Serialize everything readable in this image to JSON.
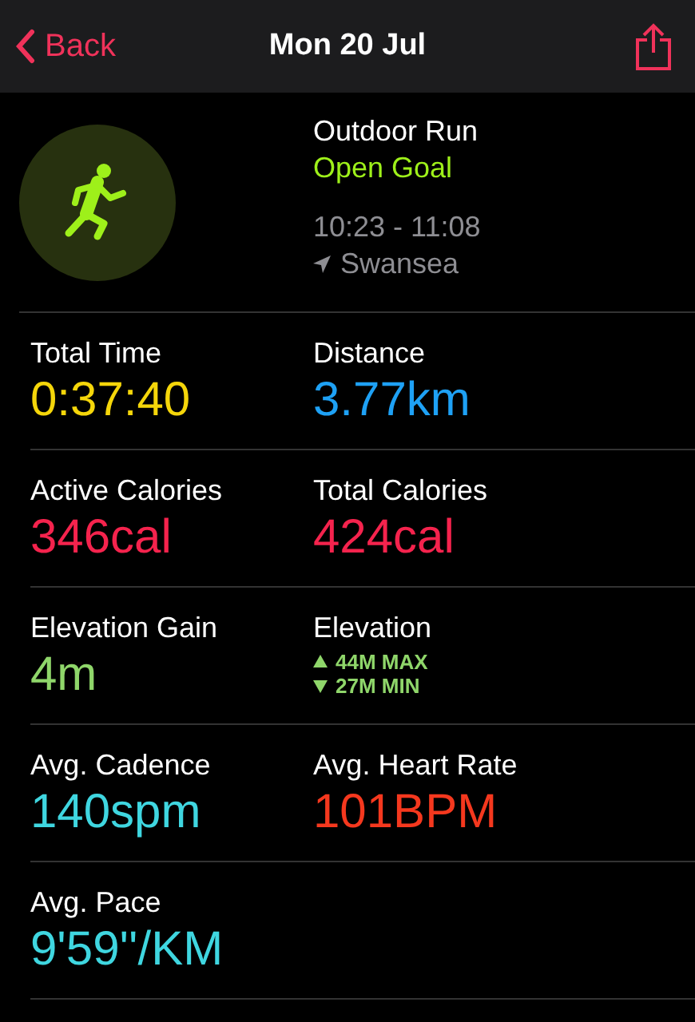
{
  "nav": {
    "back": "Back",
    "title": "Mon 20 Jul"
  },
  "workout": {
    "type": "Outdoor Run",
    "goal": "Open Goal",
    "time": "10:23 - 11:08",
    "location": "Swansea"
  },
  "metrics": [
    {
      "kind": "value",
      "label": "Total Time",
      "value": "0:37:40",
      "color": "#f5d60a"
    },
    {
      "kind": "value",
      "label": "Distance",
      "value": "3.77km",
      "color": "#1ea1f5"
    },
    {
      "kind": "value",
      "label": "Active Calories",
      "value": "346cal",
      "color": "#f5234d"
    },
    {
      "kind": "value",
      "label": "Total Calories",
      "value": "424cal",
      "color": "#f5234d"
    },
    {
      "kind": "value",
      "label": "Elevation Gain",
      "value": "4m",
      "color": "#8fd66a"
    },
    {
      "kind": "elevation",
      "label": "Elevation",
      "max": "44M MAX",
      "min": "27M MIN",
      "color": "#8fd66a"
    },
    {
      "kind": "value",
      "label": "Avg. Cadence",
      "value": "140spm",
      "color": "#3fd6e0"
    },
    {
      "kind": "value",
      "label": "Avg. Heart Rate",
      "value": "101BPM",
      "color": "#f5381e"
    },
    {
      "kind": "value",
      "label": "Avg. Pace",
      "value": "9'59''/KM",
      "color": "#3fd6e0"
    }
  ]
}
